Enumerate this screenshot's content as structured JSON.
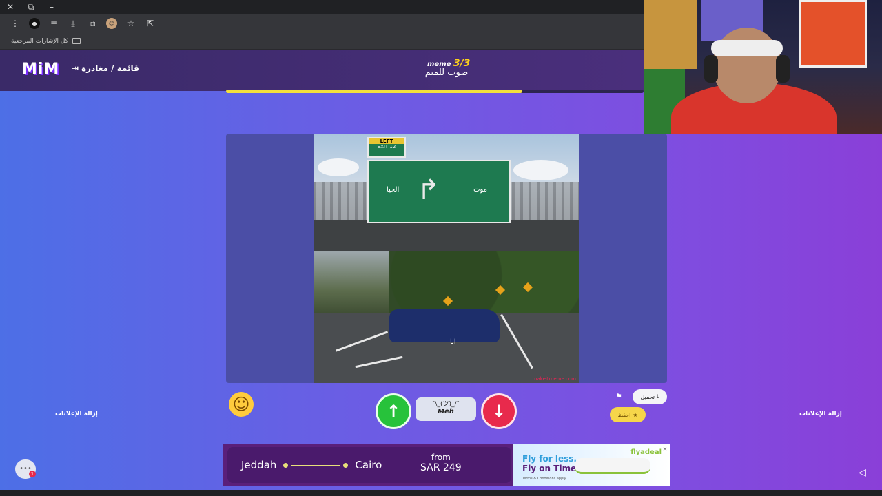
{
  "browser": {
    "controls": [
      "✕",
      "⧉",
      "–"
    ],
    "bookmarks_label": "كل الإشارات المرجعية"
  },
  "header": {
    "logo": "MiM",
    "menu_link": "قائمة / مغادرة",
    "meme_counter_prefix": "meme",
    "meme_counter_value": "3/3",
    "meme_title": "صوت للميم",
    "progress": 0.71
  },
  "meme": {
    "top_left_text": "الحيا",
    "top_right_text": "موت",
    "exit_sign_top": "LEFT",
    "exit_sign_bottom": "EXIT 12",
    "car_text": "انا",
    "watermark": "makeitmeme.com"
  },
  "controls": {
    "meh_face": "¯\\_(ツ)_/¯",
    "meh_label": "Meh",
    "download_label": "تحميل",
    "save_label": "احفظ",
    "remove_ads": "إزالة الإعلانات"
  },
  "ad": {
    "from_city": "Jeddah",
    "to_city": "Cairo",
    "from_label": "from",
    "price": "SAR 249",
    "slogan_line1": "Fly for less.",
    "slogan_line2": "Fly on Time",
    "terms": "Terms & Conditions apply",
    "brand": "flyadeal",
    "accent": "#8ac23a"
  },
  "chat": {
    "badge_count": "1"
  },
  "colors": {
    "vote_up": "#27c23b",
    "vote_down": "#e82a4c",
    "progress": "#f3e03c"
  }
}
